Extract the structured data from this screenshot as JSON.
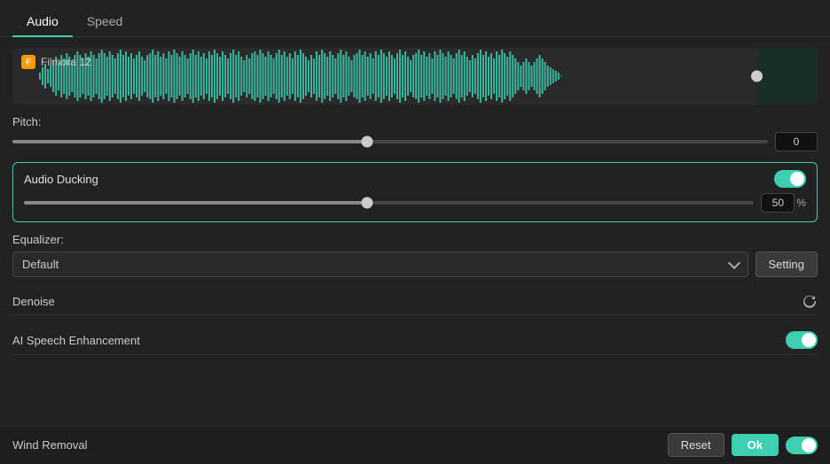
{
  "tabs": [
    {
      "label": "Audio",
      "active": true
    },
    {
      "label": "Speed",
      "active": false
    }
  ],
  "waveform": {
    "label": "Filmora 12"
  },
  "pitch": {
    "label": "Pitch:",
    "value": "0",
    "position_pct": 47
  },
  "audioDucking": {
    "title": "Audio Ducking",
    "enabled": true,
    "value": "50",
    "percent": "%",
    "position_pct": 47
  },
  "equalizer": {
    "label": "Equalizer:",
    "selected": "Default",
    "setting_btn": "Setting"
  },
  "denoise": {
    "label": "Denoise"
  },
  "aiSpeechEnhancement": {
    "label": "AI Speech Enhancement",
    "enabled": true
  },
  "windRemoval": {
    "label": "Wind Removal",
    "enabled": true
  },
  "footer": {
    "reset_btn": "Reset",
    "ok_btn": "Ok"
  }
}
